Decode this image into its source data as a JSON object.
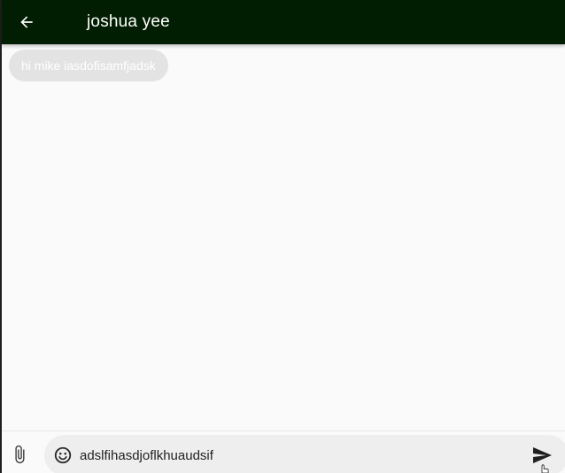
{
  "header": {
    "title": "joshua yee",
    "back_icon": "arrow-back-icon",
    "background": "#021e02"
  },
  "messages": [
    {
      "text": "hi mike iasdofisamfjadsk",
      "direction": "incoming"
    }
  ],
  "composer": {
    "input_value": "adslfihasdjoflkhuaudsif",
    "attach_icon": "paperclip-icon",
    "emoji_icon": "emoji-icon",
    "send_icon": "send-icon"
  },
  "colors": {
    "bubble": "#e3e3e3",
    "background": "#fafafa",
    "input_pill": "#eeeeee"
  }
}
